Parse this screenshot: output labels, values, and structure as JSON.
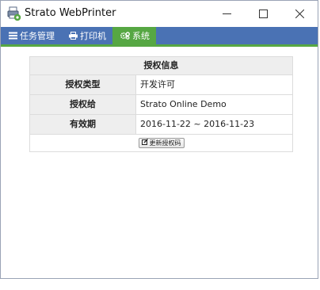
{
  "window": {
    "title": "Strato WebPrinter"
  },
  "icons": {
    "app": "printer-app-icon",
    "minimize": "minimize-icon",
    "maximize": "maximize-icon",
    "close": "close-icon",
    "tasks": "list-icon",
    "printer": "printer-icon",
    "system": "gears-icon",
    "edit": "edit-icon"
  },
  "colors": {
    "navbar": "#4a72b4",
    "active_tab": "#56a743"
  },
  "nav": {
    "tabs": [
      {
        "label": "任务管理",
        "active": false
      },
      {
        "label": "打印机",
        "active": false
      },
      {
        "label": "系统",
        "active": true
      }
    ]
  },
  "license": {
    "heading": "授权信息",
    "rows": [
      {
        "label": "授权类型",
        "value": "开发许可"
      },
      {
        "label": "授权给",
        "value": "Strato Online Demo"
      },
      {
        "label": "有效期",
        "value": "2016-11-22 ~ 2016-11-23"
      }
    ],
    "renew_button": "更新授权码"
  }
}
